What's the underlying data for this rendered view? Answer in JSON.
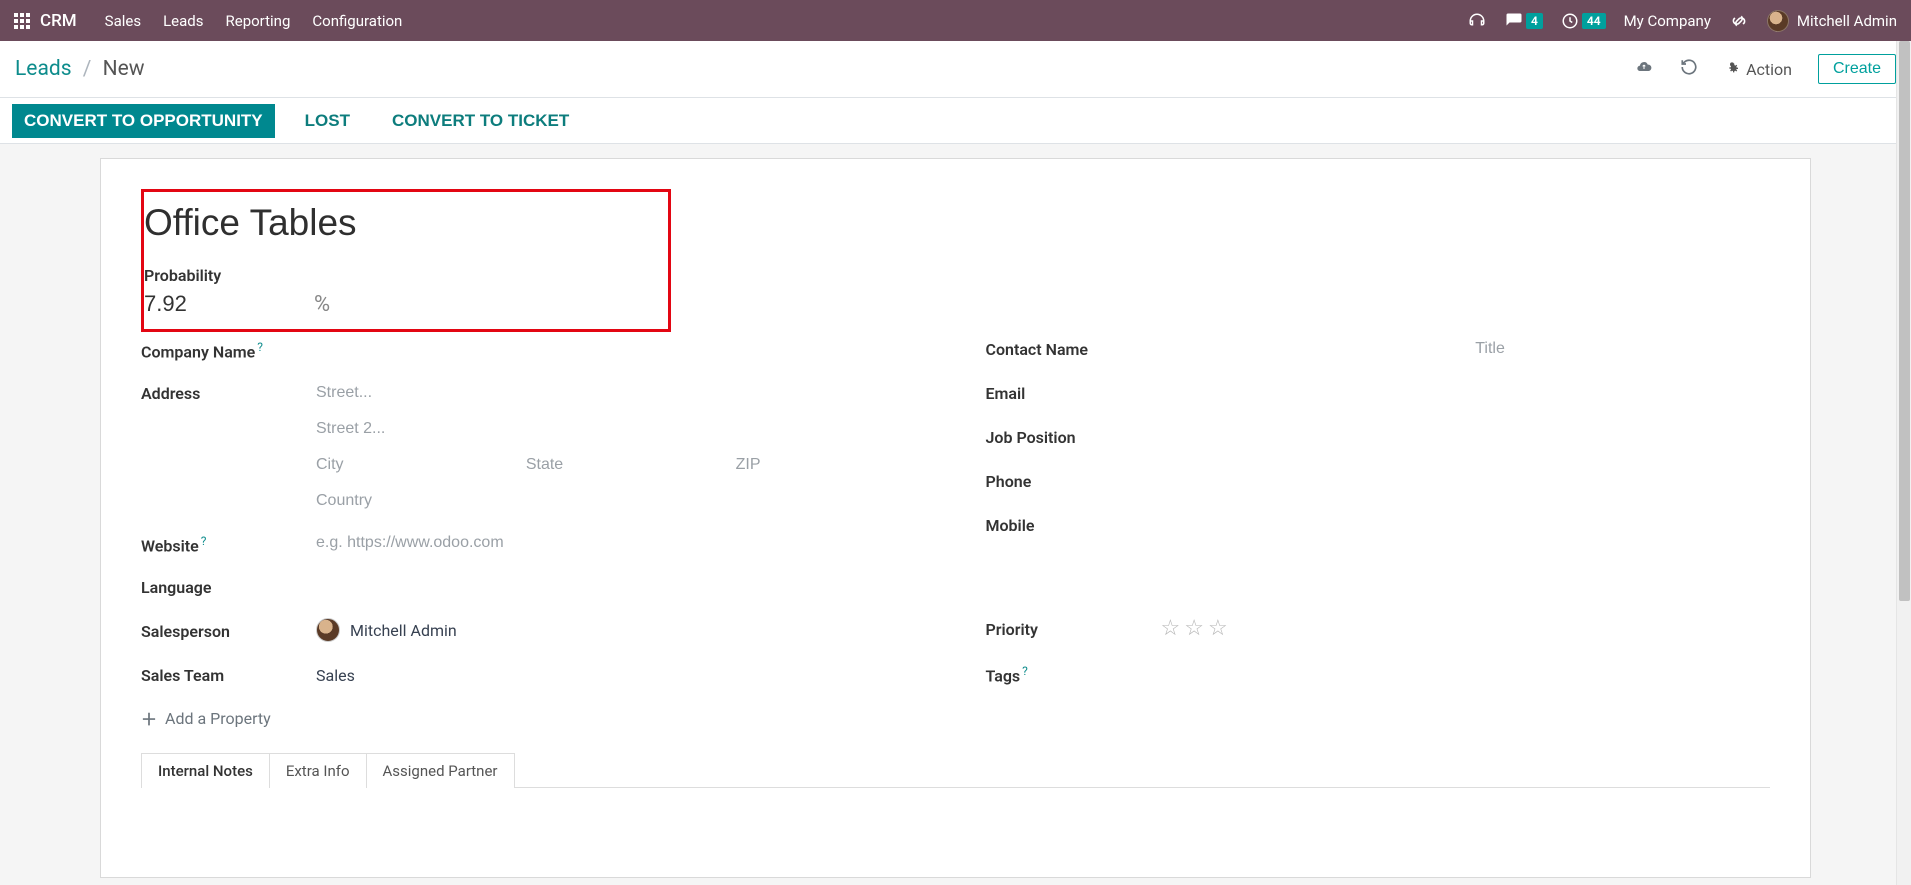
{
  "nav": {
    "brand": "CRM",
    "items": [
      "Sales",
      "Leads",
      "Reporting",
      "Configuration"
    ],
    "chat_badge": "4",
    "clock_badge": "44",
    "company": "My Company",
    "user": "Mitchell Admin"
  },
  "controlbar": {
    "breadcrumb_root": "Leads",
    "breadcrumb_current": "New",
    "action_label": "Action",
    "create_label": "Create"
  },
  "status": {
    "convert_opp": "CONVERT TO OPPORTUNITY",
    "lost": "LOST",
    "convert_ticket": "CONVERT TO TICKET"
  },
  "lead": {
    "title": "Office Tables",
    "probability_label": "Probability",
    "probability_value": "7.92",
    "percent_sign": "%"
  },
  "left": {
    "company_name_label": "Company Name",
    "address_label": "Address",
    "street_ph": "Street...",
    "street2_ph": "Street 2...",
    "city_ph": "City",
    "state_ph": "State",
    "zip_ph": "ZIP",
    "country_ph": "Country",
    "website_label": "Website",
    "website_ph": "e.g. https://www.odoo.com",
    "language_label": "Language",
    "salesperson_label": "Salesperson",
    "salesperson_value": "Mitchell Admin",
    "sales_team_label": "Sales Team",
    "sales_team_value": "Sales",
    "add_property": "Add a Property"
  },
  "right": {
    "contact_name_label": "Contact Name",
    "title_ph": "Title",
    "email_label": "Email",
    "job_label": "Job Position",
    "phone_label": "Phone",
    "mobile_label": "Mobile",
    "priority_label": "Priority",
    "tags_label": "Tags"
  },
  "tabs": {
    "t1": "Internal Notes",
    "t2": "Extra Info",
    "t3": "Assigned Partner"
  }
}
